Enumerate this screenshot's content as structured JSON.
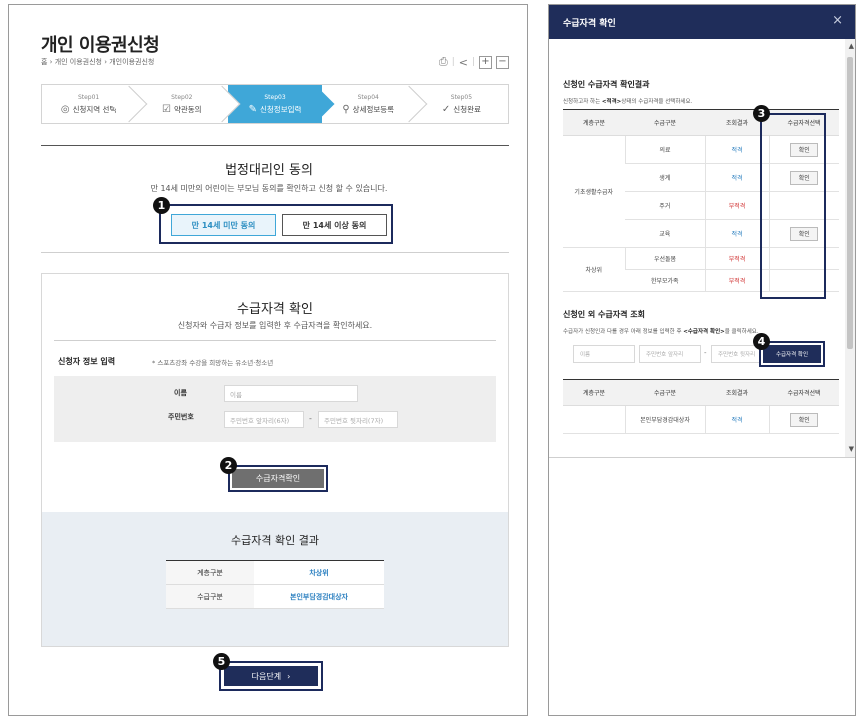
{
  "left": {
    "title": "개인 이용권신청",
    "breadcrumb": "홈 › 개인 이용권신청 › 개인이용권신청",
    "tools": {
      "print_icon": "printer-icon",
      "share_icon": "share-icon",
      "zoom_in": "+",
      "zoom_out": "−",
      "sep": "|"
    },
    "steps": [
      {
        "num": "Step01",
        "label": "신청지역 선택",
        "icon": "◎"
      },
      {
        "num": "Step02",
        "label": "약관동의",
        "icon": "☑"
      },
      {
        "num": "Step03",
        "label": "신청정보입력",
        "icon": "✎"
      },
      {
        "num": "Step04",
        "label": "상세정보등록",
        "icon": "⚲"
      },
      {
        "num": "Step05",
        "label": "신청완료",
        "icon": "✓"
      }
    ],
    "consent": {
      "title": "법정대리인 동의",
      "subtitle": "만 14세 미만의 어린이는 부모님 동의를 확인하고 신청 할 수 있습니다.",
      "under14": "만 14세 미만 동의",
      "over14": "만 14세 이상 동의"
    },
    "qualify": {
      "title": "수급자격 확인",
      "subtitle": "신청자와 수급자 정보를 입력한 후 수급자격을 확인하세요.",
      "applicant_label": "신청자 정보 입력",
      "applicant_note": "* 스포츠강좌 수강을 희망하는 유소년·청소년",
      "name_label": "이름",
      "name_placeholder": "이름",
      "rrn_label": "주민번호",
      "rrn_front_placeholder": "주민번호 앞자리(6자)",
      "rrn_back_placeholder": "주민번호 뒷자리(7자)",
      "dash": "-",
      "check_button": "수급자격확인"
    },
    "result": {
      "title": "수급자격 확인 결과",
      "rows": [
        {
          "key": "계층구분",
          "value": "차상위"
        },
        {
          "key": "수급구분",
          "value": "본인부담경감대상자"
        }
      ]
    },
    "next_button": "다음단계",
    "next_arrow": "›",
    "badges": [
      "1",
      "2",
      "5"
    ]
  },
  "modal": {
    "title": "수급자격 확인",
    "close": "×",
    "sec1": {
      "title": "신청인 수급자격 확인결과",
      "desc_pre": "신청하고자 하는 ",
      "desc_bold": "<적격>",
      "desc_post": "상태의 수급자격을 선택하세요.",
      "headers": [
        "계층구분",
        "수급구분",
        "조회결과",
        "수급자격선택"
      ],
      "group1": "기초생활수급자",
      "group2": "차상위",
      "rows": [
        {
          "type": "의료",
          "result": "적격",
          "status": "ok",
          "btn": "확인"
        },
        {
          "type": "생계",
          "result": "적격",
          "status": "ok",
          "btn": "확인"
        },
        {
          "type": "주거",
          "result": "부적격",
          "status": "ng",
          "btn": ""
        },
        {
          "type": "교육",
          "result": "적격",
          "status": "ok",
          "btn": "확인"
        },
        {
          "type": "우선돌봄",
          "result": "부적격",
          "status": "ng",
          "btn": ""
        },
        {
          "type": "한부모가족",
          "result": "부적격",
          "status": "ng",
          "btn": ""
        }
      ]
    },
    "sec2": {
      "title": "신청인 외 수급자격 조회",
      "desc_pre": "수급자가 신청인과 다를 경우 아래 정보를 입력한 후 ",
      "desc_bold": "<수급자격 확인>",
      "desc_post": "을 클릭하세요.",
      "name_placeholder": "이름",
      "rrn_front_placeholder": "주민번호 앞자리",
      "rrn_back_placeholder": "주민번호 뒷자리",
      "dash": "-",
      "button": "수급자격 확인",
      "headers": [
        "계층구분",
        "수급구분",
        "조회결과",
        "수급자격선택"
      ],
      "row": {
        "group": "",
        "type": "본인부담경감대상자",
        "result": "적격",
        "btn": "확인"
      }
    },
    "badges": [
      "3",
      "4"
    ]
  },
  "colors": {
    "navy": "#1f2d5a",
    "accent_blue": "#3fa7d8",
    "ok_blue": "#2a7fc0",
    "ng_red": "#d03030"
  }
}
